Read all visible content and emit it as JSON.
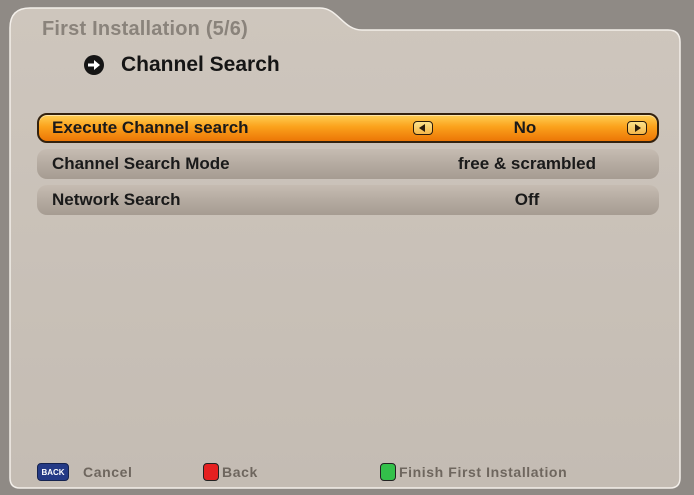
{
  "header": {
    "title": "First Installation (5/6)",
    "subtitle": "Channel Search"
  },
  "menu": {
    "rows": [
      {
        "label": "Execute Channel search",
        "value": "No",
        "selected": true
      },
      {
        "label": "Channel Search Mode",
        "value": "free & scrambled",
        "selected": false
      },
      {
        "label": "Network Search",
        "value": "Off",
        "selected": false
      }
    ]
  },
  "footer": {
    "back_key_text": "BACK",
    "cancel_label": "Cancel",
    "back_label": "Back",
    "finish_label": "Finish First Installation"
  },
  "colors": {
    "panel": "#c9c1b8",
    "background": "#8f8a85",
    "selected_row": "#fba21c",
    "red_key": "#e52020",
    "green_key": "#33c04a",
    "back_key": "#243a86"
  },
  "icons": [
    "circle-arrow-right-icon",
    "arrow-left-icon",
    "arrow-right-icon",
    "back-key-icon",
    "red-key-icon",
    "green-key-icon"
  ]
}
